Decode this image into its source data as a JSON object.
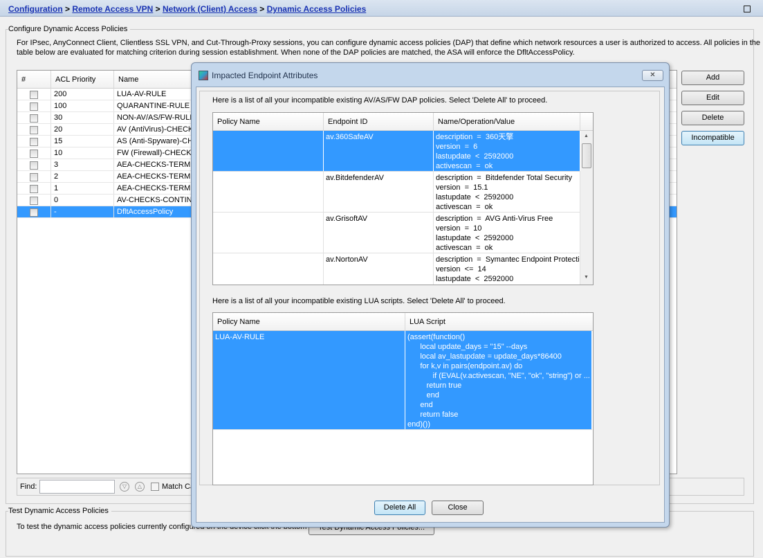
{
  "breadcrumb": {
    "items": [
      "Configuration",
      "Remote Access VPN",
      "Network (Client) Access",
      "Dynamic Access Policies"
    ],
    "sep": " > "
  },
  "config": {
    "group_title": "Configure Dynamic Access Policies",
    "description_1": "For IPsec, AnyConnect Client, Clientless SSL VPN, and Cut-Through-Proxy sessions, you can configure dynamic access policies (DAP) that define which network resources a user is authorized to access. All policies in the",
    "description_2": "table below are evaluated for matching criterion during session establishment. When none of the DAP policies are matched, the ASA will enforce the DfltAccessPolicy.",
    "columns": [
      "#",
      "ACL Priority",
      "Name"
    ],
    "rows": [
      {
        "priority": "200",
        "name": "LUA-AV-RULE"
      },
      {
        "priority": "100",
        "name": "QUARANTINE-RULE"
      },
      {
        "priority": "30",
        "name": "NON-AV/AS/FW-RULE"
      },
      {
        "priority": "20",
        "name": "AV (AntiVirus)-CHECKS"
      },
      {
        "priority": "15",
        "name": "AS (Anti-Spyware)-CHECKS"
      },
      {
        "priority": "10",
        "name": "FW (Firewall)-CHECKS"
      },
      {
        "priority": "3",
        "name": "AEA-CHECKS-TERMINATE"
      },
      {
        "priority": "2",
        "name": "AEA-CHECKS-TERMINATE"
      },
      {
        "priority": "1",
        "name": "AEA-CHECKS-TERMINATE"
      },
      {
        "priority": "0",
        "name": "AV-CHECKS-CONTINUE"
      },
      {
        "priority": "-",
        "name": "DfltAccessPolicy",
        "selected": true
      }
    ],
    "buttons": {
      "add": "Add",
      "edit": "Edit",
      "delete": "Delete",
      "incompatible": "Incompatible"
    },
    "find_label": "Find:",
    "find_value": "",
    "match_case": "Match Case"
  },
  "test": {
    "group_title": "Test Dynamic Access Policies",
    "text": "To test the dynamic access policies currently configured on the device click the bottom",
    "button": "Test Dynamic Access Policies..."
  },
  "dialog": {
    "title": "Impacted Endpoint Attributes",
    "close_glyph": "✕",
    "msg1": "Here is a list of all your incompatible existing AV/AS/FW DAP policies. Select 'Delete All' to proceed.",
    "table1": {
      "columns": [
        "Policy Name",
        "Endpoint ID",
        "Name/Operation/Value"
      ],
      "rows": [
        {
          "policy": "",
          "endpoint": "av.360SafeAV",
          "value": "description  =  360天擎\nversion  =  6\nlastupdate  <  2592000\nactivescan  =  ok",
          "selected": true
        },
        {
          "policy": "",
          "endpoint": "av.BitdefenderAV",
          "value": "description  =  Bitdefender Total Security\nversion  =  15.1\nlastupdate  <  2592000\nactivescan  =  ok"
        },
        {
          "policy": "",
          "endpoint": "av.GrisoftAV",
          "value": "description  =  AVG Anti-Virus Free\nversion  =  10\nlastupdate  <  2592000\nactivescan  =  ok"
        },
        {
          "policy": "",
          "endpoint": "av.NortonAV",
          "value": "description  =  Symantec Endpoint Protection\nversion  <=  14\nlastupdate  <  2592000"
        }
      ]
    },
    "msg2": "Here is a list of all your incompatible existing LUA scripts. Select 'Delete All' to proceed.",
    "table2": {
      "columns": [
        "Policy Name",
        "LUA Script"
      ],
      "rows": [
        {
          "policy": "LUA-AV-RULE",
          "script": "(assert(function()\n      local update_days = \"15\" --days\n      local av_lastupdate = update_days*86400\n      for k,v in pairs(endpoint.av) do\n            if (EVAL(v.activescan, \"NE\", \"ok\", \"string\") or ...\n         return true\n         end\n      end\n      return false\nend)())"
        }
      ]
    },
    "delete_all": "Delete All",
    "close": "Close"
  },
  "colors": {
    "selection": "#3399ff",
    "link": "#1a33b3"
  }
}
